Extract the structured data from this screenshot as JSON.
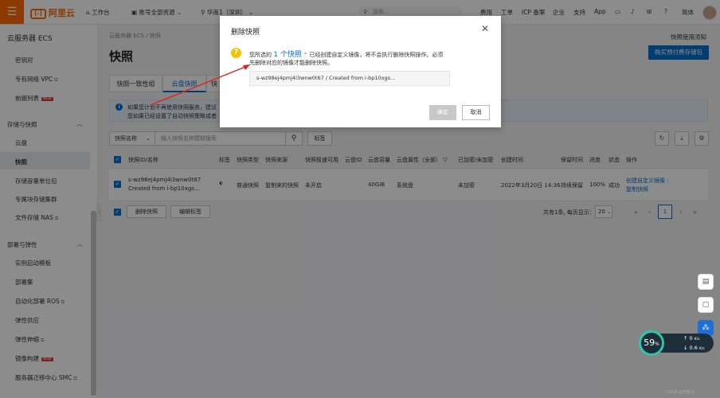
{
  "topbar": {
    "logo": "阿里云",
    "workbench": "工作台",
    "resources": "账号全部资源",
    "region": "华南1（深圳）",
    "search_placeholder": "搜索...",
    "links": [
      "费用",
      "工单",
      "ICP 备案",
      "企业",
      "支持",
      "App"
    ],
    "lang": "简体"
  },
  "sidebar": {
    "title": "云服务器 ECS",
    "items_top": [
      {
        "label": "密钥对"
      },
      {
        "label": "专有网络 VPC"
      },
      {
        "label": "前缀列表"
      }
    ],
    "group_storage": "存储与快照",
    "storage_items": [
      "云盘",
      "快照",
      "存储容量单位包",
      "专属块存储集群",
      "文件存储 NAS"
    ],
    "group_deploy": "部署与弹性",
    "deploy_items": [
      "实例启动模板",
      "部署集",
      "自动化部署 ROS",
      "弹性供应",
      "弹性伸缩",
      "镜像构建",
      "服务器迁移中心 SMC"
    ],
    "new_tag": "NEW"
  },
  "main": {
    "breadcrumb": "云服务器 ECS  /  快照",
    "title": "快照",
    "help": "快照使用须知",
    "buy_button": "购买预付费存储包",
    "tabs": [
      "快照一致性组",
      "云盘快照",
      "快"
    ],
    "notice_line1": "如果您计划不再使用快照服务，建议",
    "notice_line2": "您如果已经设置了自动快照策略或者",
    "filter_select": "快照名称",
    "search_placeholder": "输入快照名称模糊搜索",
    "tag_button": "标签"
  },
  "table": {
    "headers": [
      "快照ID/名称",
      "标签",
      "快照类型",
      "快照来源",
      "快照极速可用",
      "云盘ID",
      "云盘容量",
      "云盘属性（全部）",
      "已加密/未加密",
      "创建时间",
      "保留时间",
      "进度",
      "状态",
      "操作"
    ],
    "row": {
      "id": "s-wz98ej4pmj4i3wnw0t67",
      "name": "Created from i-bp10xgs...",
      "type": "普通快照",
      "source": "复制来的快照",
      "instant": "未开启",
      "disk_size": "40GiB",
      "disk_attr": "系统盘",
      "encryption": "未加密",
      "created": "2022年3月20日 14:36",
      "retention": "持续保留",
      "progress": "100%",
      "status": "成功",
      "action1": "创建自定义镜像",
      "action2": "复制快照"
    },
    "delete_button": "删除快照",
    "edit_tag_button": "编辑标签",
    "pager_text": "共有1条, 每页显示：",
    "page_size": "20",
    "current_page": "1"
  },
  "modal": {
    "title": "删除快照",
    "text_prefix": "您所选的",
    "count_text": "1 个快照",
    "text_suffix": "已经创建自定义镜像，将不会执行删除快照操作。必须",
    "text_line2": "先删除对应的镜像才能删除快照。",
    "snapshot_entry": "s-wz98ej4pmj4i3wnw0t67 / Created from i-bp10xgs...",
    "ok": "确定",
    "cancel": "取消"
  },
  "speed": {
    "percent": "59",
    "unit": "%",
    "up": "0",
    "up_unit": "K/s",
    "down": "0.6",
    "down_unit": "K/s"
  },
  "watermark": "CSDN @无名火"
}
